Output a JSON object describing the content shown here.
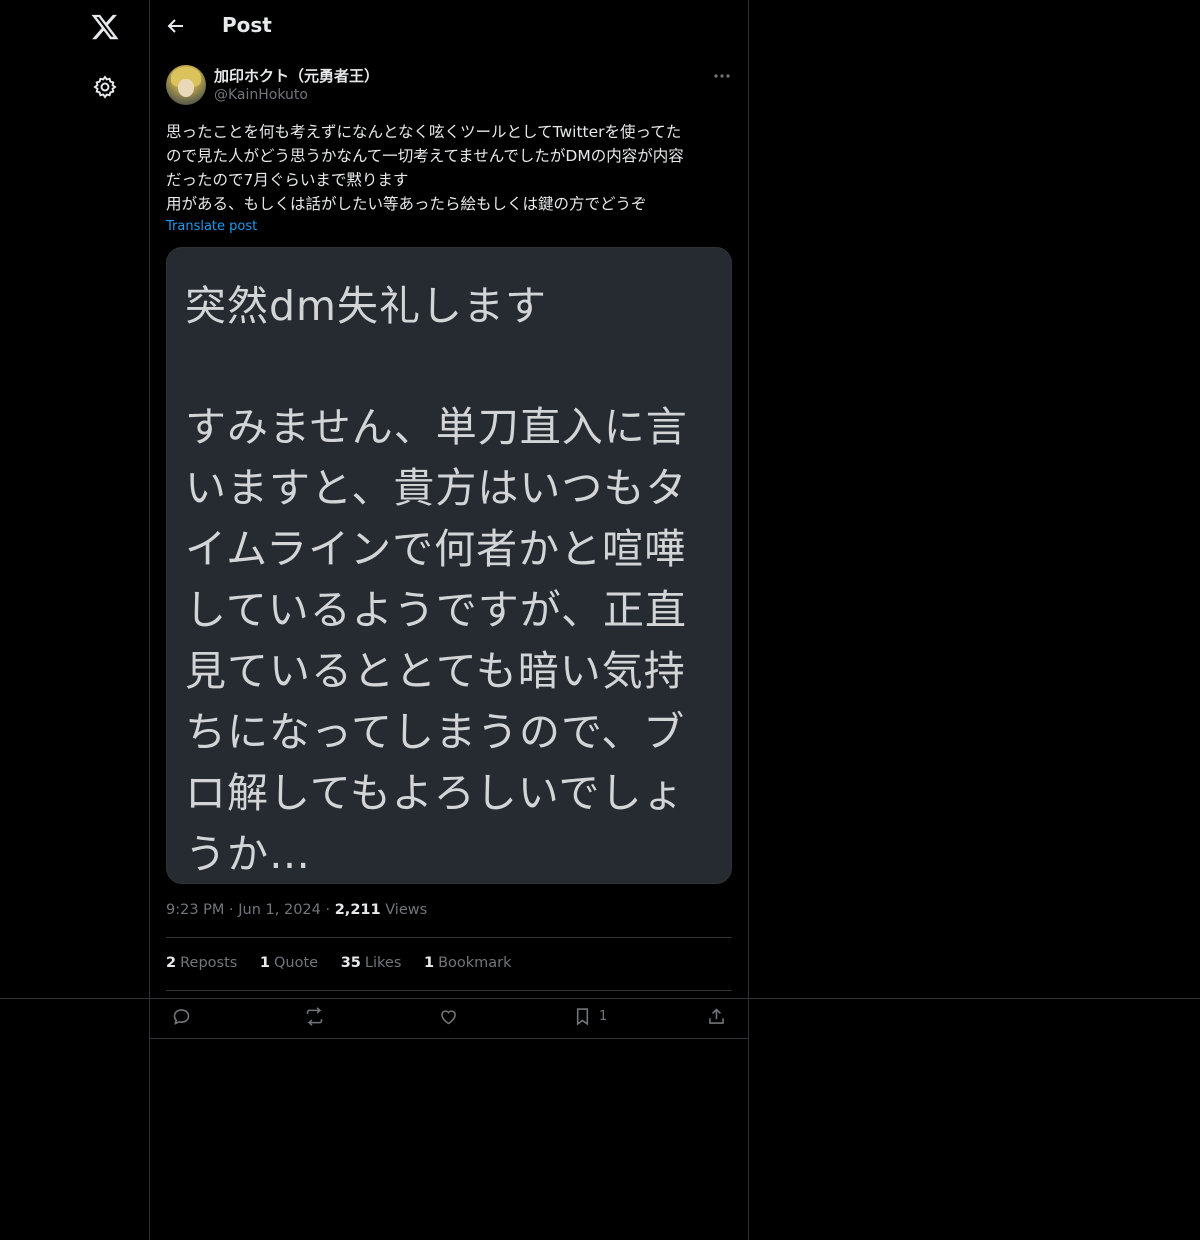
{
  "header": {
    "title": "Post"
  },
  "author": {
    "display_name": "加印ホクト（元勇者王）",
    "handle": "@KainHokuto"
  },
  "post": {
    "text": "思ったことを何も考えずになんとなく呟くツールとしてTwitterを使ってた\nので見た人がどう思うかなんて一切考えてませんでしたがDMの内容が内容\nだったので7月ぐらいまで黙ります\n用がある、もしくは話がしたい等あったら絵もしくは鍵の方でどうぞ",
    "translate_label": "Translate post",
    "image_text_lines": [
      "突然dm失礼します",
      "すみません、単刀直入に言",
      "いますと、貴方はいつもタ",
      "イムラインで何者かと喧嘩",
      "しているようですが、正直",
      "見ているととても暗い気持",
      "ちになってしまうので、ブ",
      "ロ解してもよろしいでしょ",
      "うか…"
    ]
  },
  "meta": {
    "time": "9:23 PM",
    "sep": "·",
    "date": "Jun 1, 2024",
    "views_count": "2,211",
    "views_label": "Views"
  },
  "stats": [
    {
      "count": "2",
      "label": "Reposts"
    },
    {
      "count": "1",
      "label": "Quote"
    },
    {
      "count": "35",
      "label": "Likes"
    },
    {
      "count": "1",
      "label": "Bookmark"
    }
  ],
  "actions": {
    "bookmark_count": "1"
  },
  "icons": {
    "logo": "x-logo-icon",
    "settings": "gear-icon",
    "back": "arrow-left-icon",
    "more": "more-dots-icon",
    "reply": "reply-icon",
    "repost": "repost-icon",
    "like": "heart-icon",
    "bookmark": "bookmark-icon",
    "share": "share-icon"
  },
  "colors": {
    "background": "#000000",
    "text": "#e7e9ea",
    "muted": "#71767b",
    "accent": "#1d9bf0",
    "border": "#2f3336"
  }
}
